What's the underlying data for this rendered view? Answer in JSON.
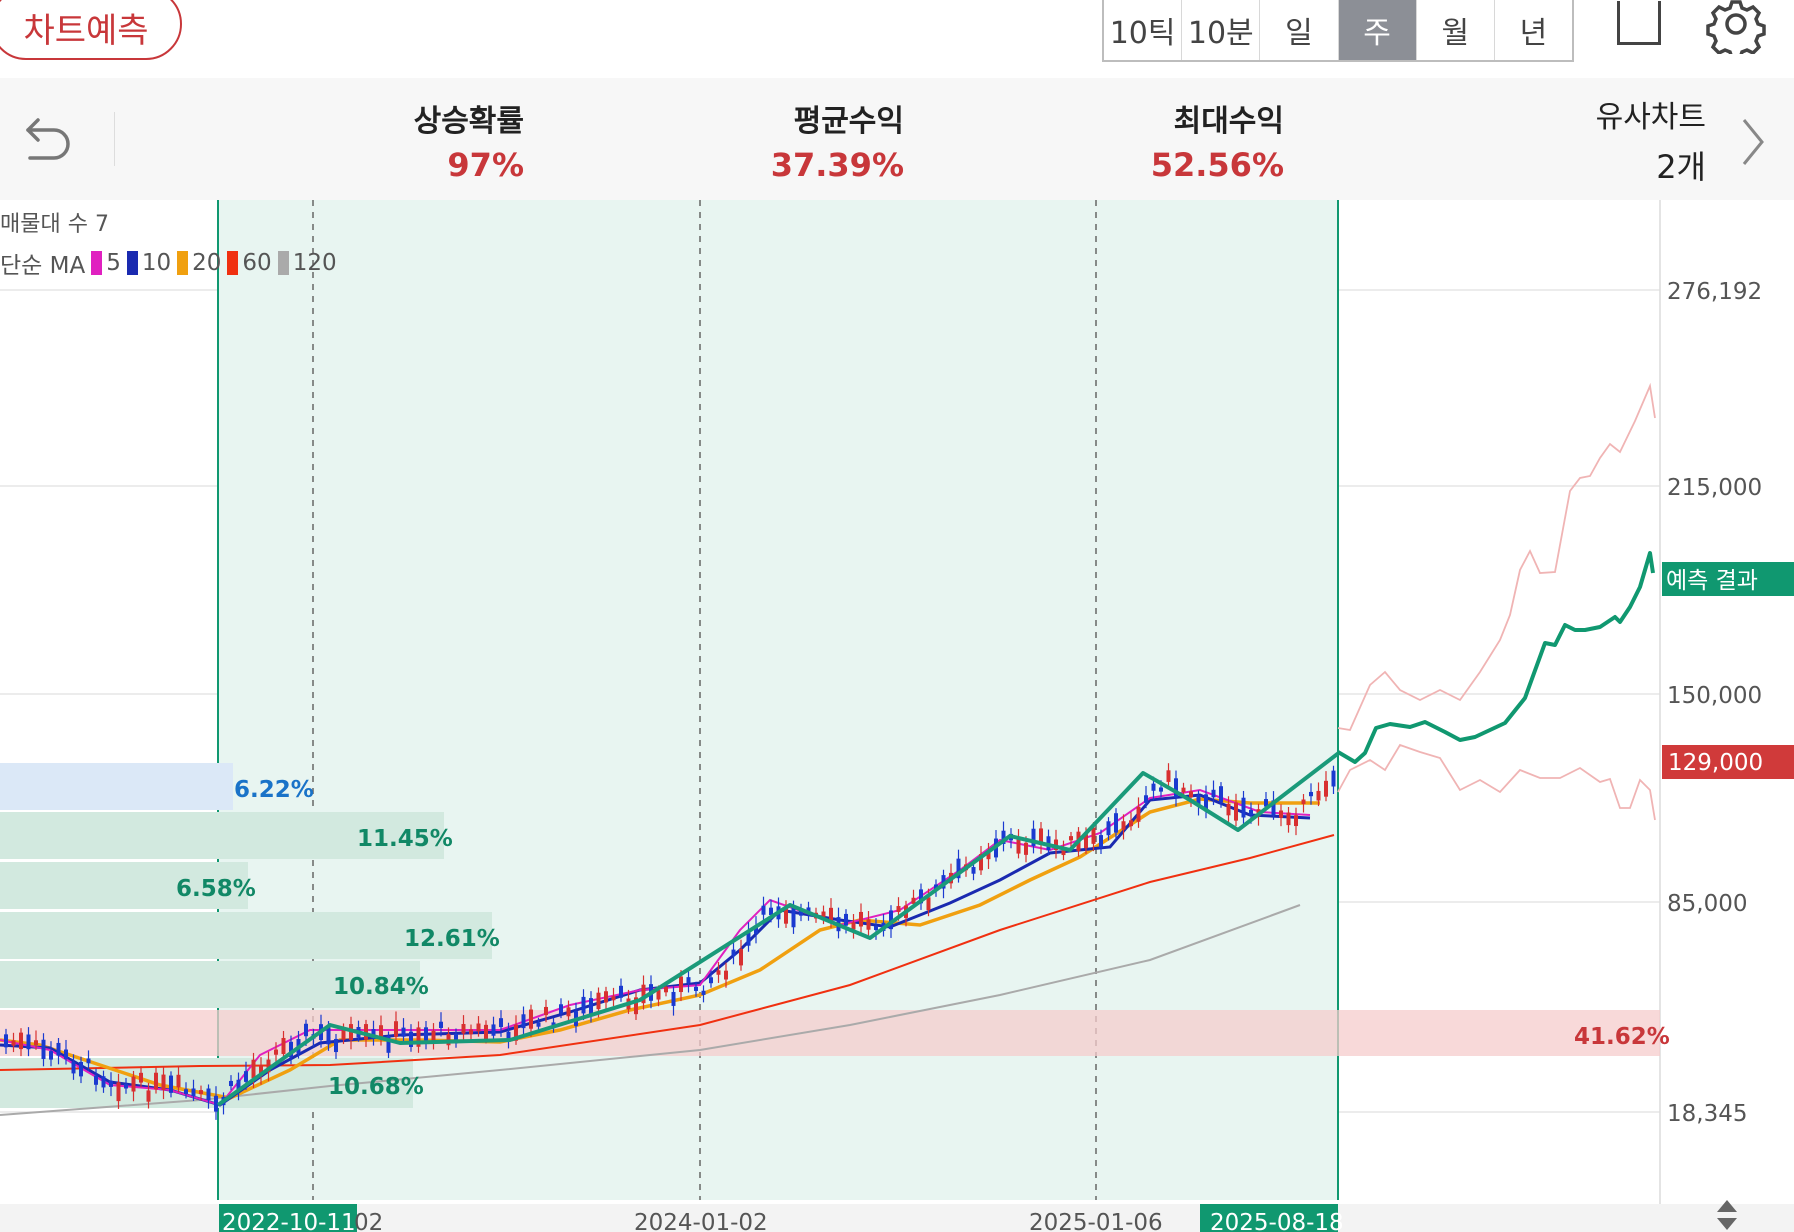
{
  "header": {
    "predict_button": "차트예측",
    "tabs": [
      {
        "label": "10틱",
        "active": false
      },
      {
        "label": "10분",
        "active": false
      },
      {
        "label": "일",
        "active": false
      },
      {
        "label": "주",
        "active": true
      },
      {
        "label": "월",
        "active": false
      },
      {
        "label": "년",
        "active": false
      }
    ]
  },
  "summary": {
    "rise_prob_label": "상승확률",
    "rise_prob_value": "97%",
    "avg_return_label": "평균수익",
    "avg_return_value": "37.39%",
    "max_return_label": "최대수익",
    "max_return_value": "52.56%",
    "similar_label": "유사차트",
    "similar_value": "2개"
  },
  "legend": {
    "volume_profile": "매물대 수 7",
    "ma_prefix": "단순 MA",
    "ma_items": [
      {
        "label": "5",
        "color": "#e020c0"
      },
      {
        "label": "10",
        "color": "#1a2ab0"
      },
      {
        "label": "20",
        "color": "#f0a010"
      },
      {
        "label": "60",
        "color": "#f03010"
      },
      {
        "label": "120",
        "color": "#aaaaaa"
      }
    ]
  },
  "chart_data": {
    "type": "candlestick",
    "interval": "weekly",
    "y_ticks": [
      "276,192",
      "215,000",
      "150,000",
      "85,000",
      "18,345"
    ],
    "current_price": "129,000",
    "prediction_label": "예측 결과",
    "x_labels": [
      "2022-10-11",
      "2024-01-02",
      "2025-01-06",
      "2025-08-18"
    ],
    "x_partial_label": "02",
    "volume_profile": [
      {
        "pct": "6.22%",
        "color": "#1a73c8"
      },
      {
        "pct": "11.45%",
        "color": "#118866"
      },
      {
        "pct": "6.58%",
        "color": "#118866"
      },
      {
        "pct": "12.61%",
        "color": "#118866"
      },
      {
        "pct": "10.84%",
        "color": "#118866"
      },
      {
        "pct": "41.62%",
        "color": "#c8373a"
      },
      {
        "pct": "10.68%",
        "color": "#118866"
      }
    ],
    "colors": {
      "up": "#d83030",
      "down": "#1a3ad0",
      "prediction": "#109870",
      "similar": "#e89c9c",
      "match_area": "#e8f5f1"
    }
  }
}
